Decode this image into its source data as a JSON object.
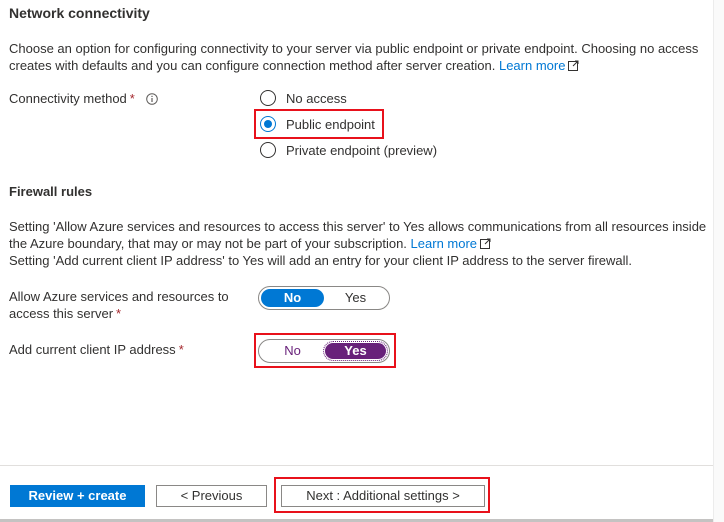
{
  "network": {
    "title": "Network connectivity",
    "description": "Choose an option for configuring connectivity to your server via public endpoint or private endpoint. Choosing no access creates with defaults and you can configure connection method after server creation.",
    "learn_more": "Learn more",
    "method_label": "Connectivity method",
    "required_mark": "*",
    "options": [
      "No access",
      "Public endpoint",
      "Private endpoint (preview)"
    ],
    "selected": "Public endpoint"
  },
  "firewall": {
    "title": "Firewall rules",
    "description_1": "Setting 'Allow Azure services and resources to access this server' to Yes allows communications from all resources inside the Azure boundary, that may or may not be part of your subscription.",
    "learn_more": "Learn more",
    "description_2": "Setting 'Add current client IP address' to Yes will add an entry for your client IP address to the server firewall.",
    "allow_azure_label": "Allow Azure services and resources to access this server",
    "allow_azure_value": "No",
    "client_ip_label": "Add current client IP address",
    "client_ip_value": "Yes",
    "required_mark": "*",
    "no_label": "No",
    "yes_label": "Yes"
  },
  "footer": {
    "review_create": "Review + create",
    "previous": "< Previous",
    "next": "Next : Additional settings >"
  },
  "colors": {
    "accent": "#0078d4",
    "toggle_yes": "#68217a",
    "highlight": "#e8111b"
  }
}
